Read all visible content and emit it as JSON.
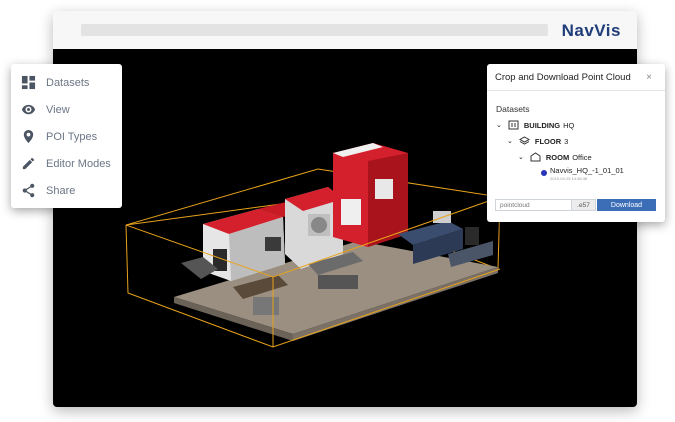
{
  "header": {
    "logo_text": "NavVis"
  },
  "menu": {
    "items": [
      {
        "label": "Datasets",
        "icon": "grid-icon"
      },
      {
        "label": "View",
        "icon": "eye-icon"
      },
      {
        "label": "POI Types",
        "icon": "location-pin-icon"
      },
      {
        "label": "Editor Modes",
        "icon": "pencil-icon"
      },
      {
        "label": "Share",
        "icon": "share-icon"
      }
    ]
  },
  "crop_panel": {
    "title": "Crop and Download Point Cloud",
    "close_glyph": "×",
    "section_label": "Datasets",
    "tree": {
      "building": {
        "kind": "BUILDING",
        "name": "HQ"
      },
      "floor": {
        "kind": "FLOOR",
        "name": "3"
      },
      "room": {
        "kind": "ROOM",
        "name": "Office"
      },
      "dataset": {
        "name": "Navvis_HQ_-1_01_01",
        "date": "2019-04-25 14:38:38"
      }
    },
    "filename_placeholder": "pointcloud",
    "extension": ".e57",
    "download_label": "Download"
  },
  "colors": {
    "accent": "#3c6eb8",
    "logo": "#1f3d7a",
    "bounding_box": "#e8a21b",
    "machine_red": "#d4202c",
    "dataset_dot": "#2a35b8"
  }
}
